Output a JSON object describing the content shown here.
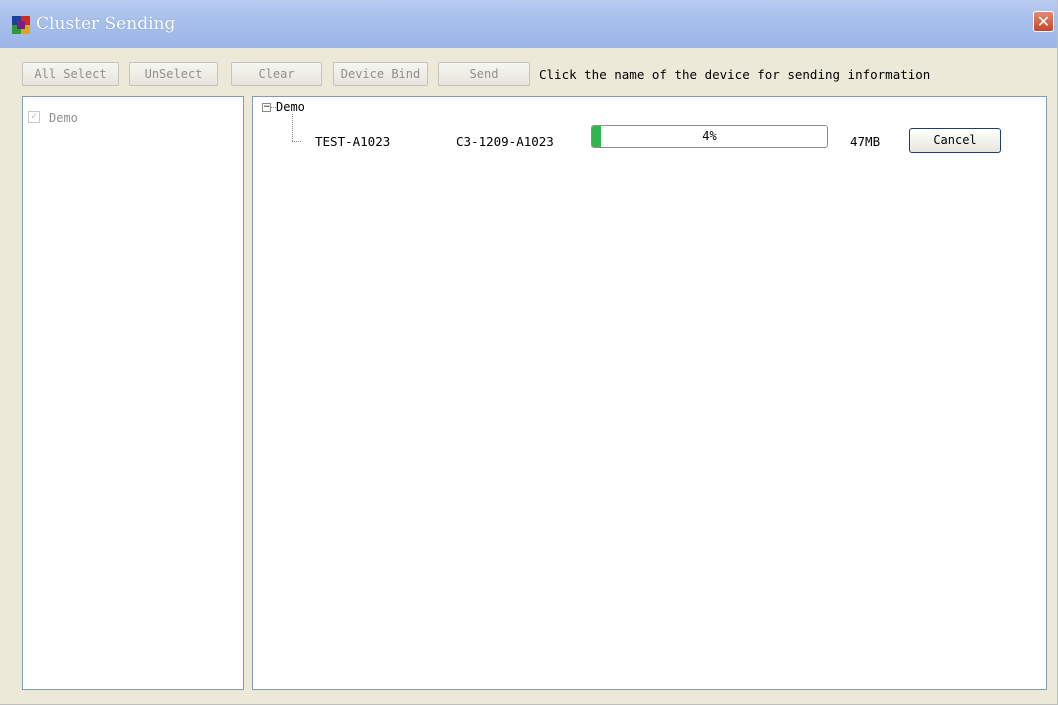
{
  "window": {
    "title": "Cluster Sending",
    "close_glyph": "✕",
    "colors": {
      "titlebar": "#a8c0ec",
      "close": "#c8442a",
      "progress_fill": "#2fb74e"
    }
  },
  "toolbar": {
    "all_select_label": "All Select",
    "unselect_label": "UnSelect",
    "clear_label": "Clear",
    "device_bind_label": "Device Bind",
    "send_label": "Send",
    "info_text": "Click the name of the device for sending information"
  },
  "groups": [
    {
      "label": "Demo",
      "checked": true
    }
  ],
  "tree": {
    "root_label": "Demo",
    "expanded": true,
    "device": {
      "name": "TEST-A1023",
      "serial": "C3-1209-A1023",
      "progress_percent": 4,
      "progress_text": "4%",
      "size": "47MB",
      "cancel_label": "Cancel"
    }
  },
  "icons": {
    "app": "app-logo-icon",
    "close": "close-icon",
    "collapse": "collapse-minus-icon",
    "check": "checkmark-icon"
  }
}
